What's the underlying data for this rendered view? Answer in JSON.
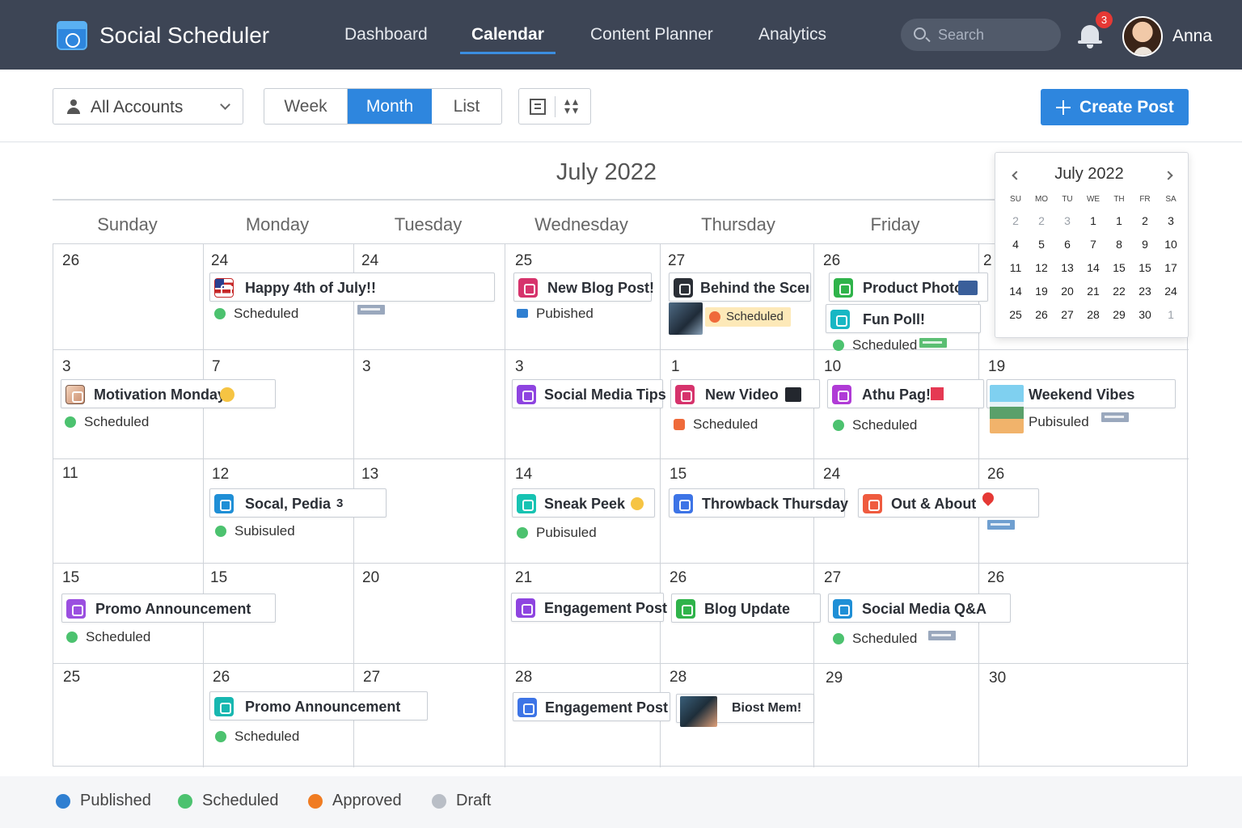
{
  "app": {
    "title": "Social Scheduler"
  },
  "nav": {
    "items": [
      "Dashboard",
      "Calendar",
      "Content Planner",
      "Analytics"
    ],
    "active": "Calendar"
  },
  "search": {
    "placeholder": "Search"
  },
  "notifications": {
    "count": "3"
  },
  "user": {
    "name": "Anna"
  },
  "toolbar": {
    "accounts_label": "All Accounts",
    "views": [
      "Week",
      "Month",
      "List"
    ],
    "active_view": "Month",
    "create_label": "Create Post"
  },
  "calendar": {
    "title": "July 2022",
    "weekdays": [
      "Sunday",
      "Monday",
      "Tuesday",
      "Wednesday",
      "Thursday",
      "Friday"
    ],
    "day_numbers": [
      [
        "26",
        "24",
        "24",
        "25",
        "27",
        "26",
        "2"
      ],
      [
        "3",
        "7",
        "3",
        "3",
        "1",
        "10",
        "19"
      ],
      [
        "11",
        "12",
        "13",
        "14",
        "15",
        "24",
        "26"
      ],
      [
        "15",
        "15",
        "20",
        "21",
        "26",
        "27",
        "26"
      ],
      [
        "25",
        "26",
        "27",
        "28",
        "28",
        "29",
        "30"
      ]
    ],
    "posts": [
      {
        "title": "Happy 4th of July!!",
        "status": "Scheduled",
        "icon_color": "#c62828"
      },
      {
        "title": "New Blog Post!",
        "status": "Pubished",
        "icon_color": "#d6336c"
      },
      {
        "title": "Behind the Scenes",
        "status": "Scheduled",
        "icon_color": "#2b2f36"
      },
      {
        "title": "Product Photo",
        "icon_color": "#2fb34a"
      },
      {
        "title": "Fun Poll!",
        "status": "Schеduled",
        "icon_color": "#17b7c4"
      },
      {
        "title": "Motivation Monday",
        "status": "Scheduled",
        "icon_color": "#d9a37a"
      },
      {
        "title": "Social Media Tips",
        "icon_color": "#8e44e0"
      },
      {
        "title": "New Video",
        "status": "Scheduled",
        "icon_color": "#d6336c"
      },
      {
        "title": "Athu Pag!",
        "status": "Scheduled",
        "icon_color": "#b03bd6"
      },
      {
        "title": "Weekend Vibes",
        "status": "Pubisuled",
        "icon_color": "#3aa0d8"
      },
      {
        "title": "Socal, Pedia",
        "status": "Subisuled",
        "extra": "3",
        "icon_color": "#1f8fd6"
      },
      {
        "title": "Sneak Peek",
        "status": "Pubisuled",
        "icon_color": "#17c3b2"
      },
      {
        "title": "Throwback Thursday",
        "icon_color": "#3d74e6"
      },
      {
        "title": "Out & About",
        "icon_color": "#ef5b3f"
      },
      {
        "title": "Promo Announcement",
        "status": "Scheduled",
        "icon_color": "#9b4fe0"
      },
      {
        "title": "Engagement Post",
        "icon_color": "#8e44e0"
      },
      {
        "title": "Blog Update",
        "icon_color": "#2fb34a"
      },
      {
        "title": "Social Media Q&A",
        "status": "Scheduled",
        "icon_color": "#1f8fd6"
      },
      {
        "title": "Promo Announcement",
        "status": "Scheduled",
        "icon_color": "#17b7b0"
      },
      {
        "title": "Engagement Post",
        "icon_color": "#3d74e6"
      },
      {
        "title": "Biost Mem!",
        "icon_color": "#3a5f7a"
      }
    ]
  },
  "mini_calendar": {
    "title": "July 2022",
    "headers": [
      "SU",
      "MO",
      "TU",
      "WE",
      "TH",
      "FR",
      "SA"
    ],
    "weeks": [
      [
        "2",
        "2",
        "3",
        "1",
        "1",
        "2",
        "3"
      ],
      [
        "4",
        "5",
        "6",
        "7",
        "8",
        "9",
        "10"
      ],
      [
        "11",
        "12",
        "13",
        "14",
        "15",
        "15",
        "17"
      ],
      [
        "14",
        "19",
        "20",
        "21",
        "22",
        "23",
        "24"
      ],
      [
        "25",
        "26",
        "27",
        "28",
        "29",
        "30",
        "1"
      ]
    ]
  },
  "legend": [
    {
      "label": "Published",
      "color": "#2f7fd1"
    },
    {
      "label": "Scheduled",
      "color": "#4cc26f"
    },
    {
      "label": "Approved",
      "color": "#f07c22"
    },
    {
      "label": "Draft",
      "color": "#b9bec6"
    }
  ],
  "colors": {
    "accent": "#2e86de",
    "topbar": "#3d4555",
    "status_scheduled": "#4cc26f"
  }
}
